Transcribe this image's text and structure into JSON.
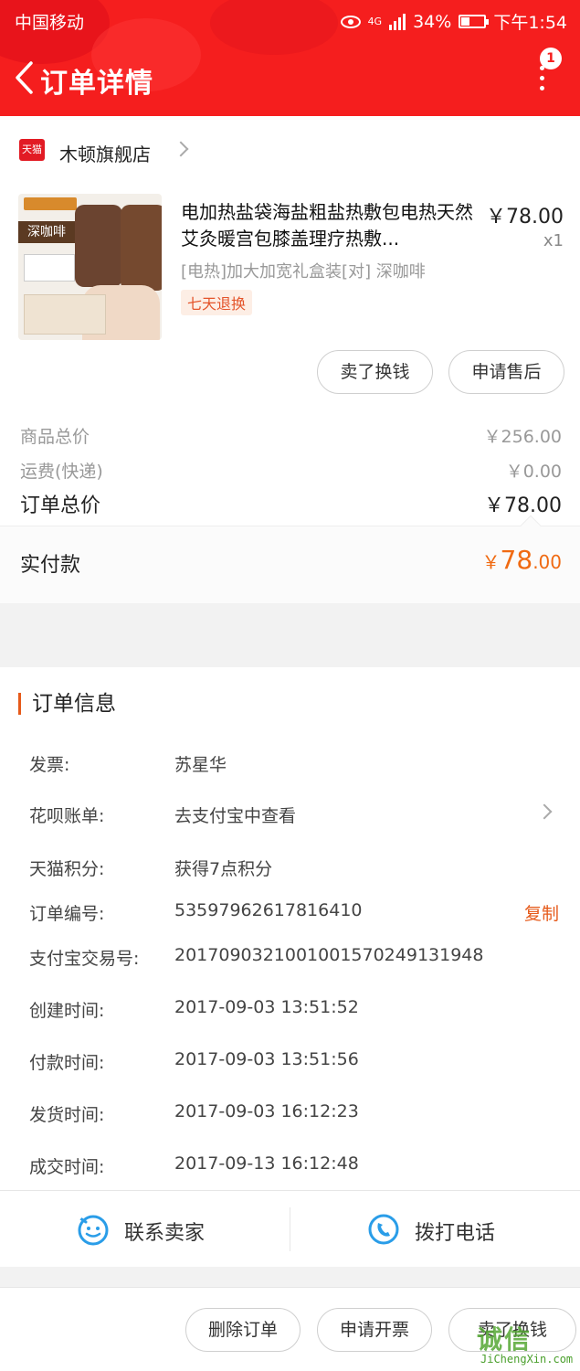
{
  "status_bar": {
    "carrier": "中国移动",
    "network": "4G",
    "battery": "34%",
    "time": "下午1:54"
  },
  "header": {
    "title": "订单详情",
    "notification_count": "1",
    "icons": [
      "back-icon",
      "more-icon"
    ]
  },
  "shop": {
    "badge": "天猫",
    "name": "木顿旗舰店"
  },
  "product": {
    "title": "电加热盐袋海盐粗盐热敷包电热天然艾灸暖宫包膝盖理疗热敷...",
    "price": "￥78.00",
    "qty": "x1",
    "sku": "[电热]加大加宽礼盒装[对] 深咖啡",
    "return_tag": "七天退换",
    "image_tag": "深咖啡"
  },
  "item_actions": {
    "sell_label": "卖了换钱",
    "aftersale_label": "申请售后"
  },
  "pricing": {
    "goods_total_label": "商品总价",
    "goods_total": "￥256.00",
    "shipping_label": "运费(快递)",
    "shipping": "￥0.00",
    "order_total_label": "订单总价",
    "order_total": "￥78.00",
    "paid_label": "实付款",
    "paid_currency": "￥",
    "paid_int": "78",
    "paid_dec": ".00"
  },
  "order_info": {
    "heading": "订单信息",
    "rows": [
      {
        "key": "发票:",
        "value": "苏星华"
      },
      {
        "key": "花呗账单:",
        "value": "去支付宝中查看"
      },
      {
        "key": "天猫积分:",
        "value": "获得7点积分"
      },
      {
        "key": "订单编号:",
        "value": "53597962617816410"
      },
      {
        "key": "支付宝交易号:",
        "value": "2017090321001001570249131948"
      },
      {
        "key": "创建时间:",
        "value": "2017-09-03 13:51:52"
      },
      {
        "key": "付款时间:",
        "value": "2017-09-03 13:51:56"
      },
      {
        "key": "发货时间:",
        "value": "2017-09-03 16:12:23"
      },
      {
        "key": "成交时间:",
        "value": "2017-09-13 16:12:48"
      }
    ],
    "copy_label": "复制"
  },
  "contact": {
    "seller_label": "联系卖家",
    "call_label": "拨打电话"
  },
  "bottom_actions": {
    "delete_label": "删除订单",
    "invoice_label": "申请开票",
    "sell_label": "卖了换钱"
  },
  "watermark": {
    "mark": "诚信",
    "url": "JiChengXin.com"
  },
  "colors": {
    "header_red": "#f51e1e",
    "accent_orange": "#e65a1a",
    "paid_orange": "#f06a12",
    "contact_blue": "#2a9de8"
  }
}
